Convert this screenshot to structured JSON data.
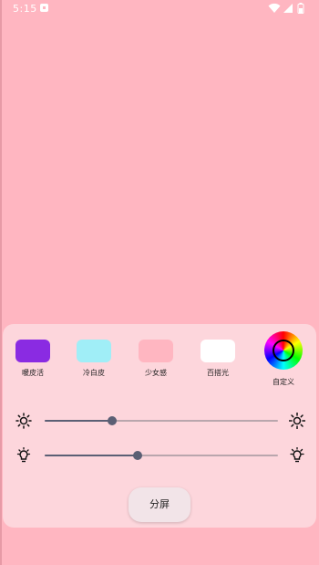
{
  "status_bar": {
    "time": "5:15",
    "icons": [
      "notification-icon",
      "wifi-icon",
      "signal-icon",
      "battery-icon"
    ]
  },
  "colors": {
    "screen_background": "#FFB6C1",
    "panel_background": "#FDD6DC",
    "slider_active": "#5b5f74",
    "slider_inactive": "#b9a6ad"
  },
  "presets": [
    {
      "label": "暖皮活",
      "color": "#8A2BE2"
    },
    {
      "label": "冷白皮",
      "color": "#A0EEF7"
    },
    {
      "label": "少女感",
      "color": "#FFB6C1"
    },
    {
      "label": "百搭光",
      "color": "#FFFFFF"
    }
  ],
  "custom": {
    "label": "自定义",
    "icon": "color-wheel-icon"
  },
  "sliders": {
    "brightness": {
      "level_percent": 29,
      "icon_left": "sun-small-icon",
      "icon_right": "sun-large-icon"
    },
    "warmth": {
      "level_percent": 40,
      "icon_left": "bulb-small-icon",
      "icon_right": "bulb-large-icon"
    }
  },
  "split_button": {
    "label": "分屏"
  }
}
